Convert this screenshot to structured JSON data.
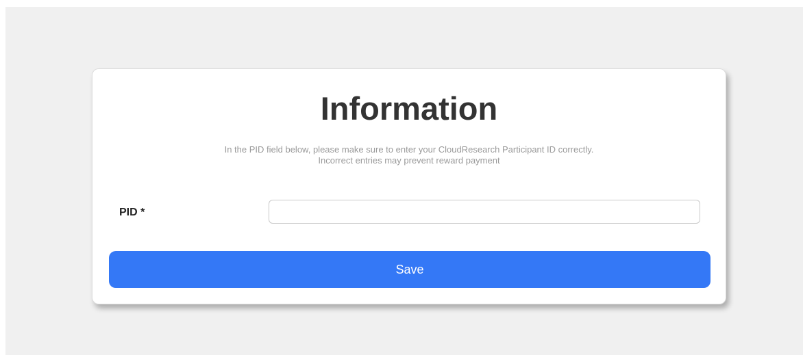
{
  "card": {
    "title": "Information",
    "notice_line1": "In the PID field below, please make sure to enter your CloudResearch Participant ID correctly.",
    "notice_line2": "Incorrect entries may prevent reward payment"
  },
  "form": {
    "pid_label": "PID *",
    "pid_value": "",
    "pid_placeholder": "",
    "save_label": "Save"
  },
  "colors": {
    "accent": "#3478f6",
    "background": "#f0f0f0",
    "card": "#ffffff"
  }
}
